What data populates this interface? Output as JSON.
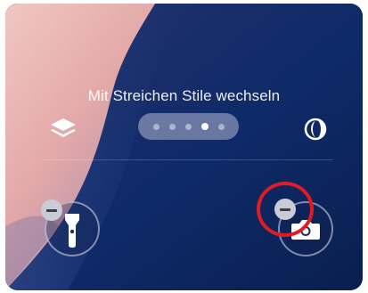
{
  "hint_text": "Mit Streichen Stile wechseln",
  "styles_pager": {
    "dot_count": 5,
    "active_index": 3
  },
  "icons": {
    "layers": "layers-icon",
    "contrast": "contrast-icon",
    "flashlight": "flashlight-icon",
    "camera": "camera-icon",
    "remove_badge": "minus-icon"
  },
  "colors": {
    "background": "#0f2a63",
    "highlight_ring": "#e11b22"
  }
}
